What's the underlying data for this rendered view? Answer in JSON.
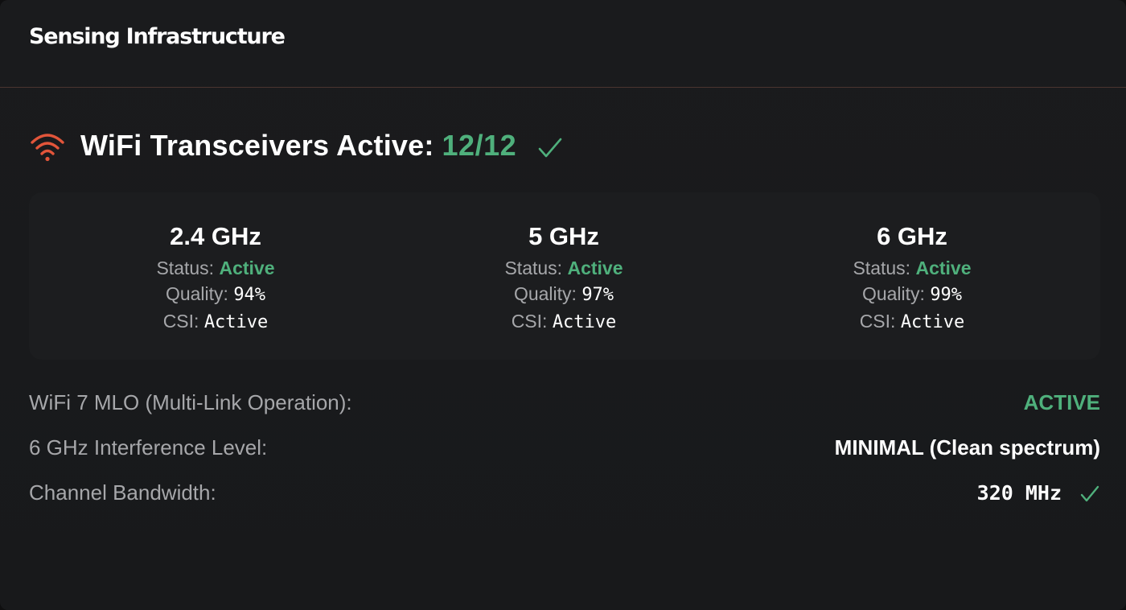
{
  "panel": {
    "title": "Sensing Infrastructure"
  },
  "transceivers": {
    "label": "WiFi Transceivers Active:",
    "count": "12/12",
    "icon": "wifi-icon",
    "check_icon": "check-icon"
  },
  "bands": [
    {
      "name": "2.4 GHz",
      "status_label": "Status:",
      "status_value": "Active",
      "quality_label": "Quality:",
      "quality_value": "94%",
      "csi_label": "CSI:",
      "csi_value": "Active"
    },
    {
      "name": "5 GHz",
      "status_label": "Status:",
      "status_value": "Active",
      "quality_label": "Quality:",
      "quality_value": "97%",
      "csi_label": "CSI:",
      "csi_value": "Active"
    },
    {
      "name": "6 GHz",
      "status_label": "Status:",
      "status_value": "Active",
      "quality_label": "Quality:",
      "quality_value": "99%",
      "csi_label": "CSI:",
      "csi_value": "Active"
    }
  ],
  "details": [
    {
      "label": "WiFi 7 MLO (Multi-Link Operation):",
      "value": "ACTIVE"
    },
    {
      "label": "6 GHz Interference Level:",
      "value": "MINIMAL (Clean spectrum)"
    },
    {
      "label": "Channel Bandwidth:",
      "value": "320 MHz"
    }
  ],
  "colors": {
    "accent_green": "#4fb07c",
    "wifi_orange": "#e2553a",
    "background": "#1a1b1d",
    "card": "#1c1d1f",
    "muted_text": "#a6a7aa"
  }
}
